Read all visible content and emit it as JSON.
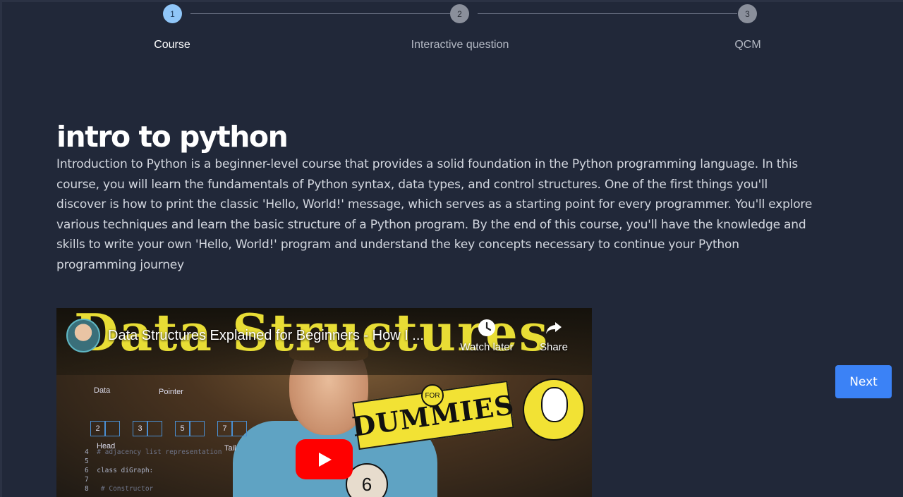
{
  "stepper": {
    "steps": [
      {
        "number": "1",
        "label": "Course",
        "state": "active"
      },
      {
        "number": "2",
        "label": "Interactive question",
        "state": "inactive"
      },
      {
        "number": "3",
        "label": "QCM",
        "state": "inactive"
      }
    ]
  },
  "course": {
    "title": "intro to python",
    "description": "Introduction to Python is a beginner-level course that provides a solid foundation in the Python programming language. In this course, you will learn the fundamentals of Python syntax, data types, and control structures. One of the first things you'll discover is how to print the classic 'Hello, World!' message, which serves as a starting point for every programmer. You'll explore various techniques and learn the basic structure of a Python program. By the end of this course, you'll have the knowledge and skills to write your own 'Hello, World!' program and understand the key concepts necessary to continue your Python programming journey"
  },
  "video": {
    "title": "Data Structures Explained for Beginners - How I ...",
    "thumbnail_heading": "Data Structures",
    "watch_later_label": "Watch later",
    "share_label": "Share",
    "badge_for": "FOR",
    "badge_dummies": "DUMMIES",
    "ball_number": "6",
    "diagram": {
      "data_label": "Data",
      "pointer_label": "Pointer",
      "head_label": "Head",
      "tail_label": "Tail",
      "nodes": [
        "2",
        "3",
        "5",
        "7"
      ]
    },
    "code_lines": [
      {
        "num": "4",
        "text": "# adjacency list representation"
      },
      {
        "num": "5",
        "text": ""
      },
      {
        "num": "6",
        "text": "class diGraph:"
      },
      {
        "num": "7",
        "text": ""
      },
      {
        "num": "8",
        "text": "    # Constructor"
      }
    ]
  },
  "navigation": {
    "next_label": "Next"
  },
  "colors": {
    "background": "#212839",
    "accent": "#3b82f6",
    "active_step": "#90c6f8",
    "inactive_step": "#8a8f9b",
    "youtube_red": "#ff0000"
  }
}
